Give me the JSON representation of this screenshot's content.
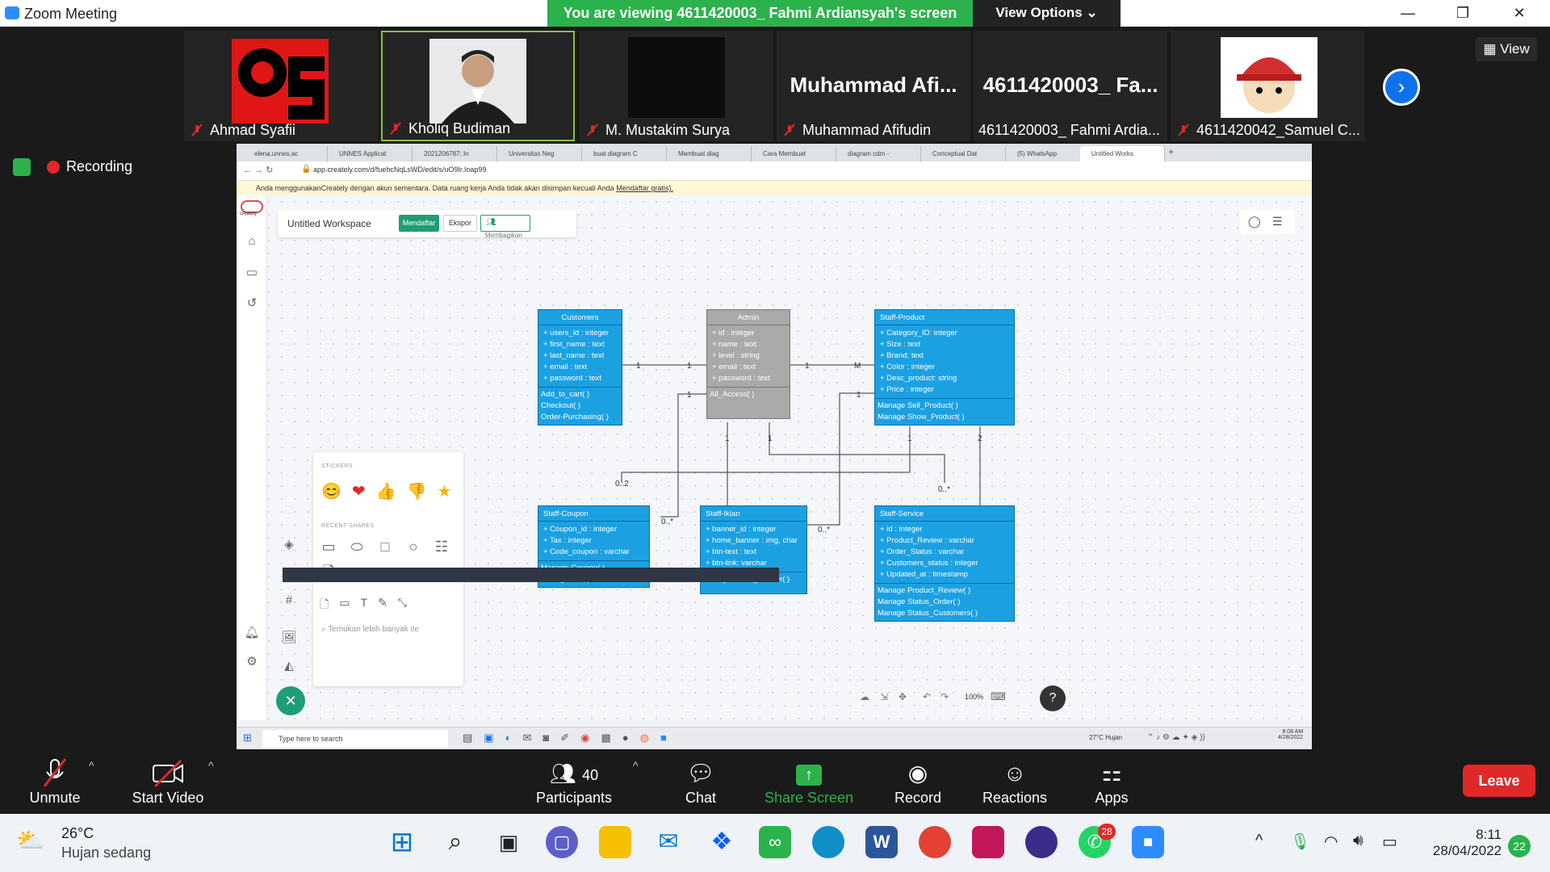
{
  "window": {
    "title": "Zoom Meeting",
    "viewing_banner": "You are viewing 4611420003_ Fahmi Ardiansyah's screen",
    "view_options": "View Options",
    "view_button": "View"
  },
  "participants": [
    {
      "name": "Ahmad Syafii"
    },
    {
      "name": "Kholiq Budiman"
    },
    {
      "name": "M. Mustakim Surya"
    },
    {
      "name": "Muhammad Afifudin",
      "display": "Muhammad  Afi..."
    },
    {
      "name": "4611420003_ Fahmi Ardia...",
      "display": "4611420003_  Fa..."
    },
    {
      "name": "4611420042_Samuel C..."
    }
  ],
  "recording": "Recording",
  "browser": {
    "tabs": [
      "elena.unnes.ac",
      "UNNES Applicat",
      "2021206787: In",
      "Universitas Neg",
      "buat diagram C",
      "Membuat diag",
      "Cara Membuat",
      "diagram cdm -",
      "Conceptual Dat",
      "(5) WhatsApp",
      "Untitled Works"
    ],
    "url": "app.creately.com/d/fuehcNqLsWD/edit/s/uO9Ir.Ioap99",
    "warning": "Anda menggunakanCreately dengan akun sementara. Data ruang kerja Anda tidak akan disimpan kecuali Anda ",
    "warning_link": "Mendaftar gratis).",
    "workspace_name": "Untitled Workspace",
    "daftar": "Mendaftar",
    "ekspor": "Ekspor",
    "bagikan": "Membagikan",
    "logo": "creately"
  },
  "uml": {
    "customers": {
      "title": "Customers",
      "attrs": [
        "+ users_id : integer",
        "+ first_name : text",
        "+ last_name : text",
        "+ email : text",
        "+ password : text"
      ],
      "methods": [
        "Add_to_cart( )",
        "Checkout( )",
        "Order-Purchasing( )"
      ]
    },
    "admin": {
      "title": "Admin",
      "attrs": [
        "+ id : integer",
        "+ name : text",
        "+ level : string",
        "+ email : text",
        "+ password : text"
      ],
      "methods": [
        "All_Access( )"
      ]
    },
    "staff_product": {
      "title": "Staff-Product",
      "attrs": [
        "+ Category_ID: integer",
        "+ Size : text",
        "+ Brand: text",
        "+ Color : integer",
        "+ Desc_product: string",
        "+ Price : integer"
      ],
      "methods": [
        "Manage Sell_Product( )",
        "Manage Show_Product( )"
      ]
    },
    "staff_coupon": {
      "title": "Staff-Coupon",
      "attrs": [
        "+ Coupon_id : integer",
        "+ Tax : integer",
        "+ Code_coupon : varchar"
      ],
      "methods": [
        "Manage Coupon( )",
        "Manage Tax( )"
      ]
    },
    "staff_iklan": {
      "title": "Staff-Iklan",
      "attrs": [
        "+ banner_id : integer",
        "+ home_banner : img, char",
        "+ btn-text : text",
        "+ btn-link: varchar"
      ],
      "methods": [
        "Manage Home_Banner( )"
      ]
    },
    "staff_service": {
      "title": "Staff-Service",
      "attrs": [
        "+ id : integer",
        "+ Product_Review : varchar",
        "+ Order_Status : varchar",
        "+ Customers_status : integer",
        "+ Updated_at : timestamp"
      ],
      "methods": [
        "Manage Product_Review( )",
        "Manage Status_Order( )",
        "Manage Status_Customers( )"
      ]
    },
    "multiplicities": [
      "1",
      "1",
      "1",
      "M",
      "1",
      "1",
      "1",
      "1",
      "2",
      "0..2",
      "0..*",
      "0..*",
      "0..*",
      "1"
    ]
  },
  "stickers_panel": {
    "stickers_title": "STICKERS",
    "recent_title": "RECENT SHAPES",
    "search_placeholder": "Temukan lebih banyak ite"
  },
  "canvas_tools": {
    "zoom": "100%",
    "help": "?"
  },
  "inner_taskbar": {
    "search": "Type here to search",
    "weather": "27°C  Hujan",
    "time": "8:08 AM",
    "date": "4/28/2022"
  },
  "controls": {
    "unmute": "Unmute",
    "start_video": "Start Video",
    "participants": "Participants",
    "participants_count": "40",
    "chat": "Chat",
    "share": "Share Screen",
    "record": "Record",
    "reactions": "Reactions",
    "apps": "Apps",
    "leave": "Leave"
  },
  "taskbar": {
    "temp": "26°C",
    "weather": "Hujan sedang",
    "time": "8:11",
    "date": "28/04/2022",
    "notif_count": "22",
    "whatsapp_badge": "28"
  },
  "colors": {
    "class_blue": "#1ba1e2",
    "zoom_green": "#2bb24c",
    "leave_red": "#e02828",
    "creately_green": "#1f9d75"
  }
}
